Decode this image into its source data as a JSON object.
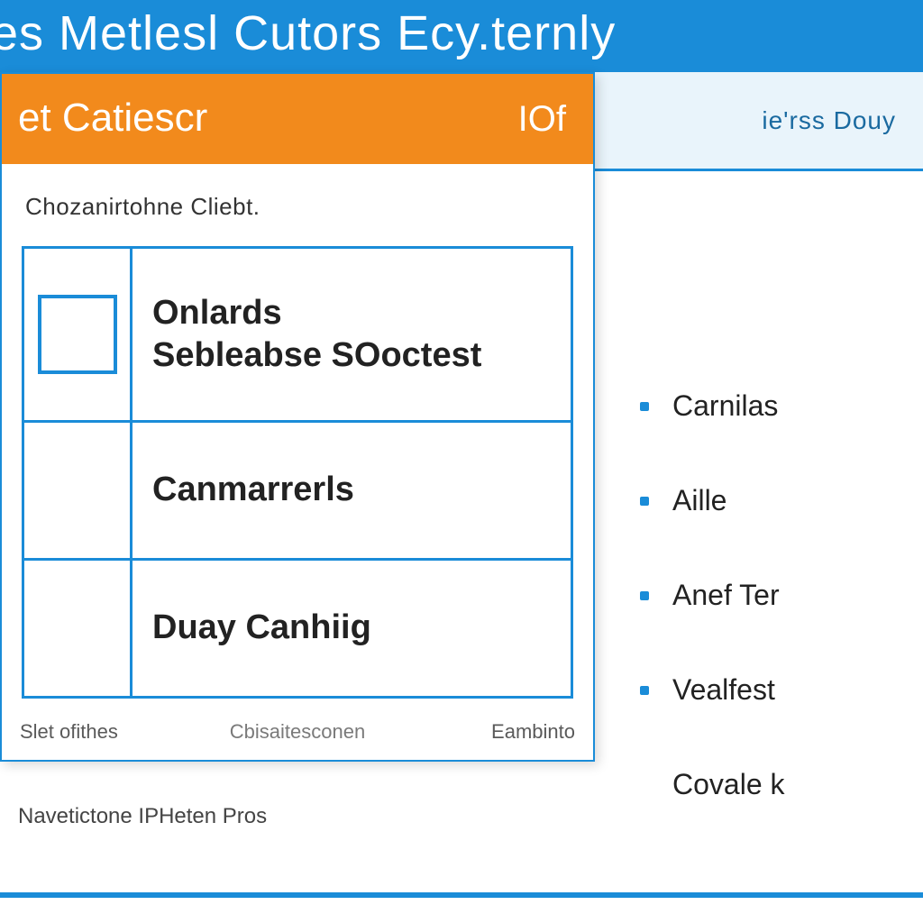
{
  "topbar": {
    "title": "es Metlesl Cutors Ecy.ternly"
  },
  "ribbon": {
    "right_label": "ie'rss  Douy"
  },
  "panel": {
    "title_left": "et Catiescr",
    "title_right": "IOf",
    "caption": "Chozanirtohne Cliebt.",
    "rows": [
      {
        "line1": "Onlards",
        "line2": "Sebleabse SOoctest"
      },
      {
        "line1": "Canmarrerls"
      },
      {
        "line1": "Duay Canhiig"
      }
    ],
    "footer": {
      "left": "Slet ofithes",
      "center": "Cbisaitesconen",
      "right": "Eambinto"
    }
  },
  "below_panel": "Navetictone IPHeten Pros",
  "side": {
    "items": [
      "Carnilas",
      "Aille",
      "Anef Ter",
      "Vealfest",
      "Covale k"
    ]
  }
}
